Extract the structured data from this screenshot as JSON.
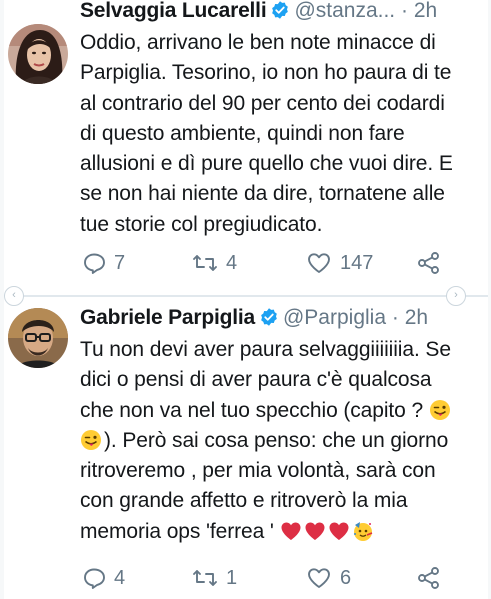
{
  "tweets": [
    {
      "author_name": "Selvaggia Lucarelli",
      "handle": "@stanza...",
      "separator": "·",
      "time": "2h",
      "text_lines": [
        "Oddio, arrivano le ben note minacce di",
        "Parpiglia. Tesorino, io non ho paura di te",
        "al contrario del 90 per cento dei codardi",
        "di questo ambiente, quindi non fare",
        "allusioni e dì pure quello che vuoi dire. E",
        "se non hai niente da dire, tornatene alle",
        "tue storie col pregiudicato."
      ],
      "replies": "7",
      "retweets": "4",
      "likes": "147"
    },
    {
      "author_name": "Gabriele Parpiglia",
      "handle": "@Parpiglia",
      "separator": "·",
      "time": "2h",
      "text_lines": [
        "Tu non devi aver paura selvaggiiiiiiia. Se",
        "dici o pensi di aver paura c'è qualcosa",
        "che non va nel tuo specchio (capito ?",
        "). Però sai cosa penso: che un giorno",
        "ritroveremo , per mia volontà, sarà con",
        "con grande affetto e ritroverò la mia",
        "memoria ops  'ferrea '"
      ],
      "replies": "4",
      "retweets": "1",
      "likes": "6"
    }
  ],
  "icons": {
    "verified": "verified-badge-icon",
    "reply": "reply-icon",
    "retweet": "retweet-icon",
    "like": "heart-icon",
    "share": "share-icon",
    "emoji_wink": "winking-tongue-emoji",
    "emoji_heart": "red-heart-emoji",
    "emoji_party": "partying-face-emoji"
  },
  "colors": {
    "verified": "#1da1f2",
    "muted": "#657786",
    "text": "#14171a",
    "heart": "#e0245e"
  }
}
